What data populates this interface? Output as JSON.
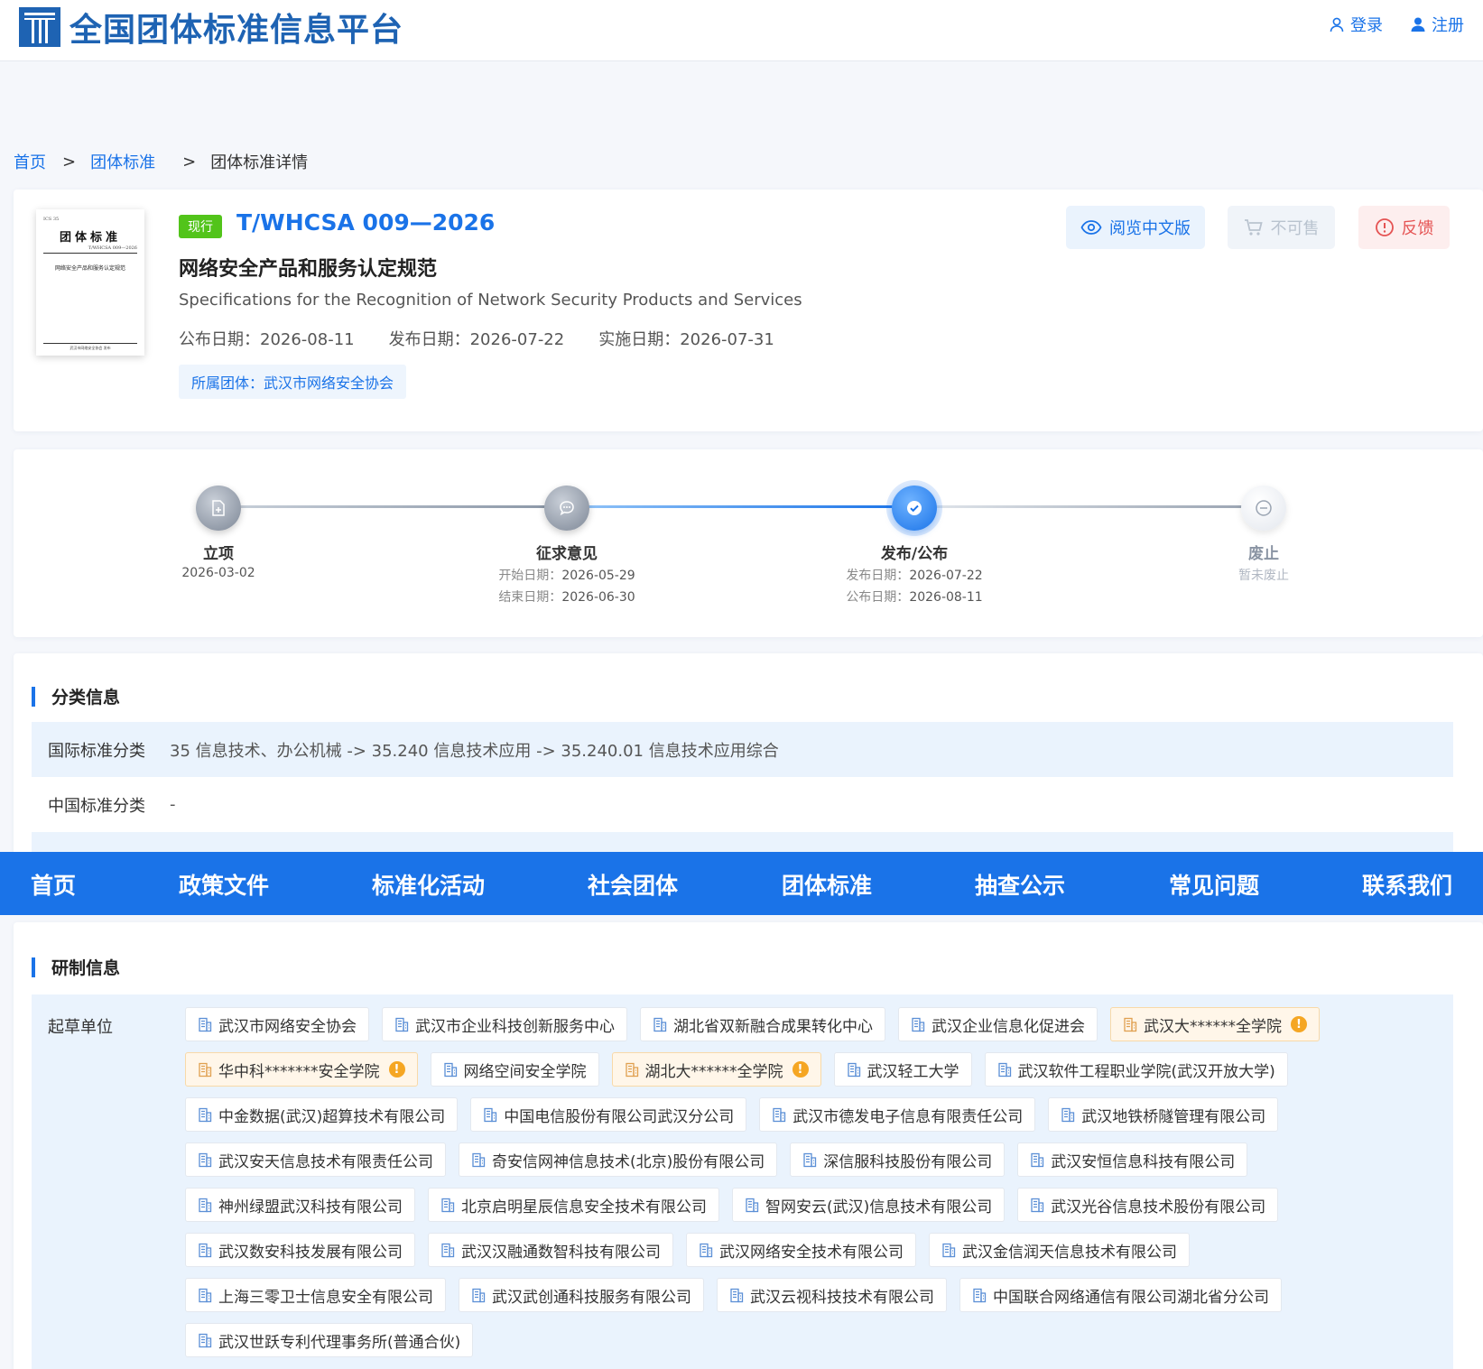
{
  "header": {
    "site_title": "全国团体标准信息平台",
    "login": "登录",
    "register": "注册"
  },
  "breadcrumb": {
    "home": "首页",
    "sep": ">",
    "group_standard": "团体标准",
    "current": "团体标准详情"
  },
  "cover": {
    "ics": "ICS  35",
    "heading": "团体标准",
    "code": "T/WHCSA 009—2026",
    "name": "网络安全产品和服务认定规范",
    "foot": "武汉市网络安全协会 发布"
  },
  "standard": {
    "status": "现行",
    "code": "T/WHCSA 009—2026",
    "title": "网络安全产品和服务认定规范",
    "title_en": "Specifications for the Recognition of Network Security Products and Services",
    "announce_date": "公布日期：2026-08-11",
    "release_date": "发布日期：2026-07-22",
    "implement_date": "实施日期：2026-07-31",
    "org": "所属团体：武汉市网络安全协会"
  },
  "actions": {
    "read": "阅览中文版",
    "buy": "不可售",
    "feedback": "反馈"
  },
  "timeline": [
    {
      "label": "立项",
      "date": "2026-03-02"
    },
    {
      "label": "征求意见",
      "k1": "开始日期：",
      "v1": "2026-05-29",
      "k2": "结束日期：",
      "v2": "2026-06-30"
    },
    {
      "label": "发布/公布",
      "k1": "发布日期：",
      "v1": "2026-07-22",
      "k2": "公布日期：",
      "v2": "2026-08-11"
    },
    {
      "label": "废止",
      "note": "暂未废止"
    }
  ],
  "classification": {
    "title": "分类信息",
    "ics_label": "国际标准分类",
    "ics_value": "35 信息技术、办公机械 -> 35.240 信息技术应用 -> 35.240.01 信息技术应用综合",
    "ccs_label": "中国标准分类",
    "ccs_value": "-"
  },
  "nav": [
    "首页",
    "政策文件",
    "标准化活动",
    "社会团体",
    "团体标准",
    "抽查公示",
    "常见问题",
    "联系我们"
  ],
  "development": {
    "title": "研制信息",
    "draft_label": "起草单位",
    "units": [
      {
        "name": "武汉市网络安全协会",
        "warn": false
      },
      {
        "name": "武汉市企业科技创新服务中心",
        "warn": false
      },
      {
        "name": "湖北省双新融合成果转化中心",
        "warn": false
      },
      {
        "name": "武汉企业信息化促进会",
        "warn": false
      },
      {
        "name": "武汉大******全学院",
        "warn": true
      },
      {
        "name": "华中科*******安全学院",
        "warn": true
      },
      {
        "name": "网络空间安全学院",
        "warn": false
      },
      {
        "name": "湖北大******全学院",
        "warn": true
      },
      {
        "name": "武汉轻工大学",
        "warn": false
      },
      {
        "name": "武汉软件工程职业学院(武汉开放大学)",
        "warn": false
      },
      {
        "name": "中金数据(武汉)超算技术有限公司",
        "warn": false
      },
      {
        "name": "中国电信股份有限公司武汉分公司",
        "warn": false
      },
      {
        "name": "武汉市德发电子信息有限责任公司",
        "warn": false
      },
      {
        "name": "武汉地铁桥隧管理有限公司",
        "warn": false
      },
      {
        "name": "武汉安天信息技术有限责任公司",
        "warn": false
      },
      {
        "name": "奇安信网神信息技术(北京)股份有限公司",
        "warn": false
      },
      {
        "name": "深信服科技股份有限公司",
        "warn": false
      },
      {
        "name": "武汉安恒信息科技有限公司",
        "warn": false
      },
      {
        "name": "神州绿盟武汉科技有限公司",
        "warn": false
      },
      {
        "name": "北京启明星辰信息安全技术有限公司",
        "warn": false
      },
      {
        "name": "智网安云(武汉)信息技术有限公司",
        "warn": false
      },
      {
        "name": "武汉光谷信息技术股份有限公司",
        "warn": false
      },
      {
        "name": "武汉数安科技发展有限公司",
        "warn": false
      },
      {
        "name": "武汉汉融通数智科技有限公司",
        "warn": false
      },
      {
        "name": "武汉网络安全技术有限公司",
        "warn": false
      },
      {
        "name": "武汉金信润天信息技术有限公司",
        "warn": false
      },
      {
        "name": "上海三零卫士信息安全有限公司",
        "warn": false
      },
      {
        "name": "武汉武创通科技服务有限公司",
        "warn": false
      },
      {
        "name": "武汉云视科技技术有限公司",
        "warn": false
      },
      {
        "name": "中国联合网络通信有限公司湖北省分公司",
        "warn": false
      },
      {
        "name": "武汉世跃专利代理事务所(普通合伙)",
        "warn": false
      }
    ]
  },
  "colors": {
    "primary": "#1a73e8",
    "status_green": "#52c41a",
    "warn_orange": "#f5a623",
    "danger": "#e55353"
  }
}
